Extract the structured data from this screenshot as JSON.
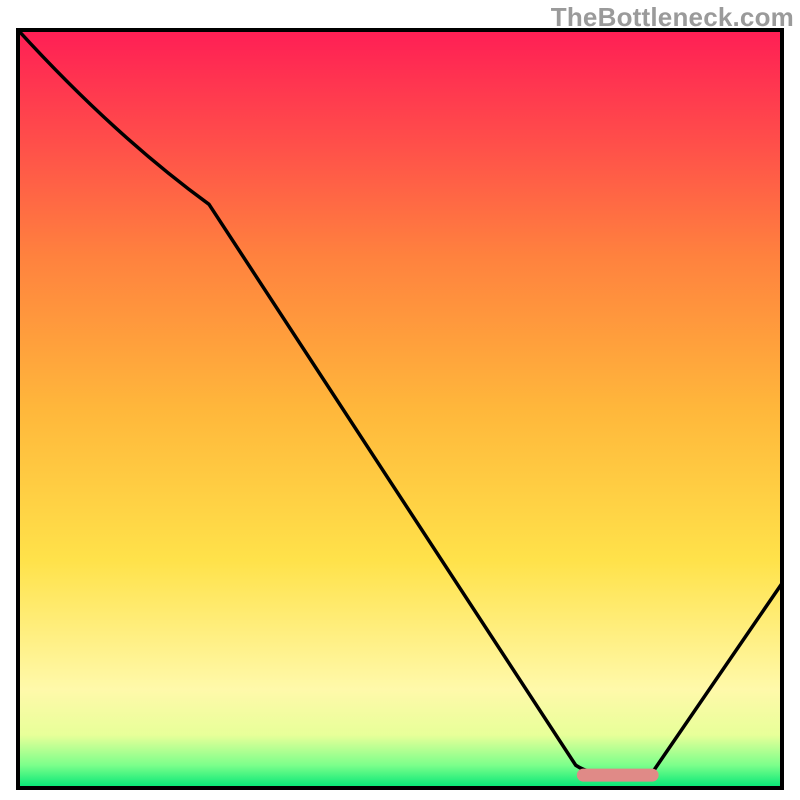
{
  "watermark": "TheBottleneck.com",
  "chart_data": {
    "type": "line",
    "title": "",
    "xlabel": "",
    "ylabel": "",
    "xlim": [
      0,
      100
    ],
    "ylim": [
      0,
      100
    ],
    "x": [
      0,
      25,
      73,
      76,
      83,
      100
    ],
    "values": [
      100,
      77,
      3,
      1.5,
      2,
      27
    ],
    "marker_segment": {
      "x0": 74,
      "x1": 83,
      "y": 1.7
    },
    "background_gradient": {
      "stops": [
        {
          "offset": 0.0,
          "color": "#00e676"
        },
        {
          "offset": 0.03,
          "color": "#7cff8b"
        },
        {
          "offset": 0.07,
          "color": "#e8ff99"
        },
        {
          "offset": 0.13,
          "color": "#fff9aa"
        },
        {
          "offset": 0.3,
          "color": "#ffe24a"
        },
        {
          "offset": 0.5,
          "color": "#ffb73b"
        },
        {
          "offset": 0.7,
          "color": "#ff823e"
        },
        {
          "offset": 0.85,
          "color": "#ff4f4a"
        },
        {
          "offset": 1.0,
          "color": "#ff1e55"
        }
      ]
    },
    "curve_stroke": "#000000",
    "marker_color": "#e08a87",
    "frame_color": "#000000"
  }
}
